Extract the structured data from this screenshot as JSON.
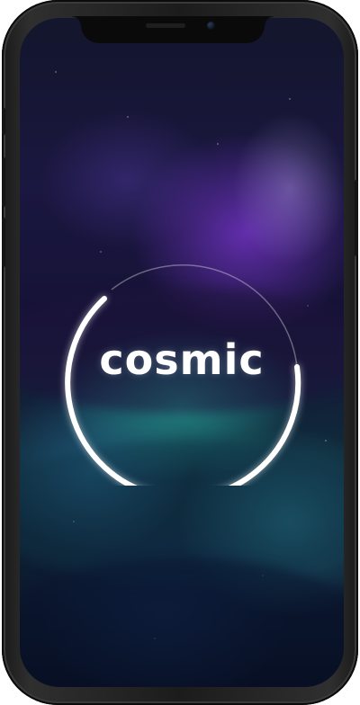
{
  "app": {
    "logo_text": "cosmic"
  },
  "splash": {
    "ring_color": "#ffffff",
    "accent_colors": [
      "#6e32be",
      "#28aaa0",
      "#13162c"
    ]
  },
  "icons": {
    "logo_ring": "circle-ring-icon"
  }
}
